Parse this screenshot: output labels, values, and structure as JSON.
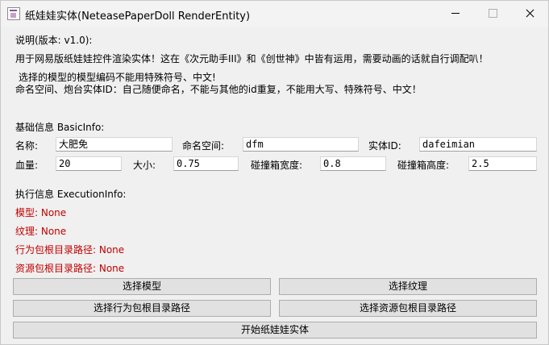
{
  "window": {
    "title": "纸娃娃实体(NeteasePaperDoll RenderEntity)",
    "controls": [
      "minimize-icon",
      "maximize-icon",
      "close-icon"
    ]
  },
  "description": {
    "heading": "说明(版本: v1.0):",
    "line1": "用于网易版纸娃娃控件渲染实体！这在《次元助手III》和《创世神》中皆有运用，需要动画的话就自行调配叭！",
    "line2": " 选择的模型的模型编码不能用特殊符号、中文!",
    "line3": "命名空间、炮台实体ID：自己随便命名，不能与其他的id重复，不能用大写、特殊符号、中文！"
  },
  "basic_info": {
    "heading": "基础信息 BasicInfo:",
    "name_label": "名称:",
    "name_value": "大肥免",
    "namespace_label": "命名空间:",
    "namespace_value": "dfm",
    "entity_id_label": "实体ID:",
    "entity_id_value": "dafeimian",
    "health_label": "血量:",
    "health_value": "20",
    "size_label": "大小:",
    "size_value": "0.75",
    "box_width_label": "碰撞箱宽度:",
    "box_width_value": "0.8",
    "box_height_label": "碰撞箱高度:",
    "box_height_value": "2.5"
  },
  "execution_info": {
    "heading": "执行信息 ExecutionInfo:",
    "model": "模型: None",
    "texture": "纹理: None",
    "behavior_path": "行为包根目录路径: None",
    "resource_path": "资源包根目录路径: None"
  },
  "buttons": {
    "select_model": "选择模型",
    "select_texture": "选择纹理",
    "select_behavior_path": "选择行为包根目录路径",
    "select_resource_path": "选择资源包根目录路径",
    "start": "开始纸娃娃实体"
  }
}
